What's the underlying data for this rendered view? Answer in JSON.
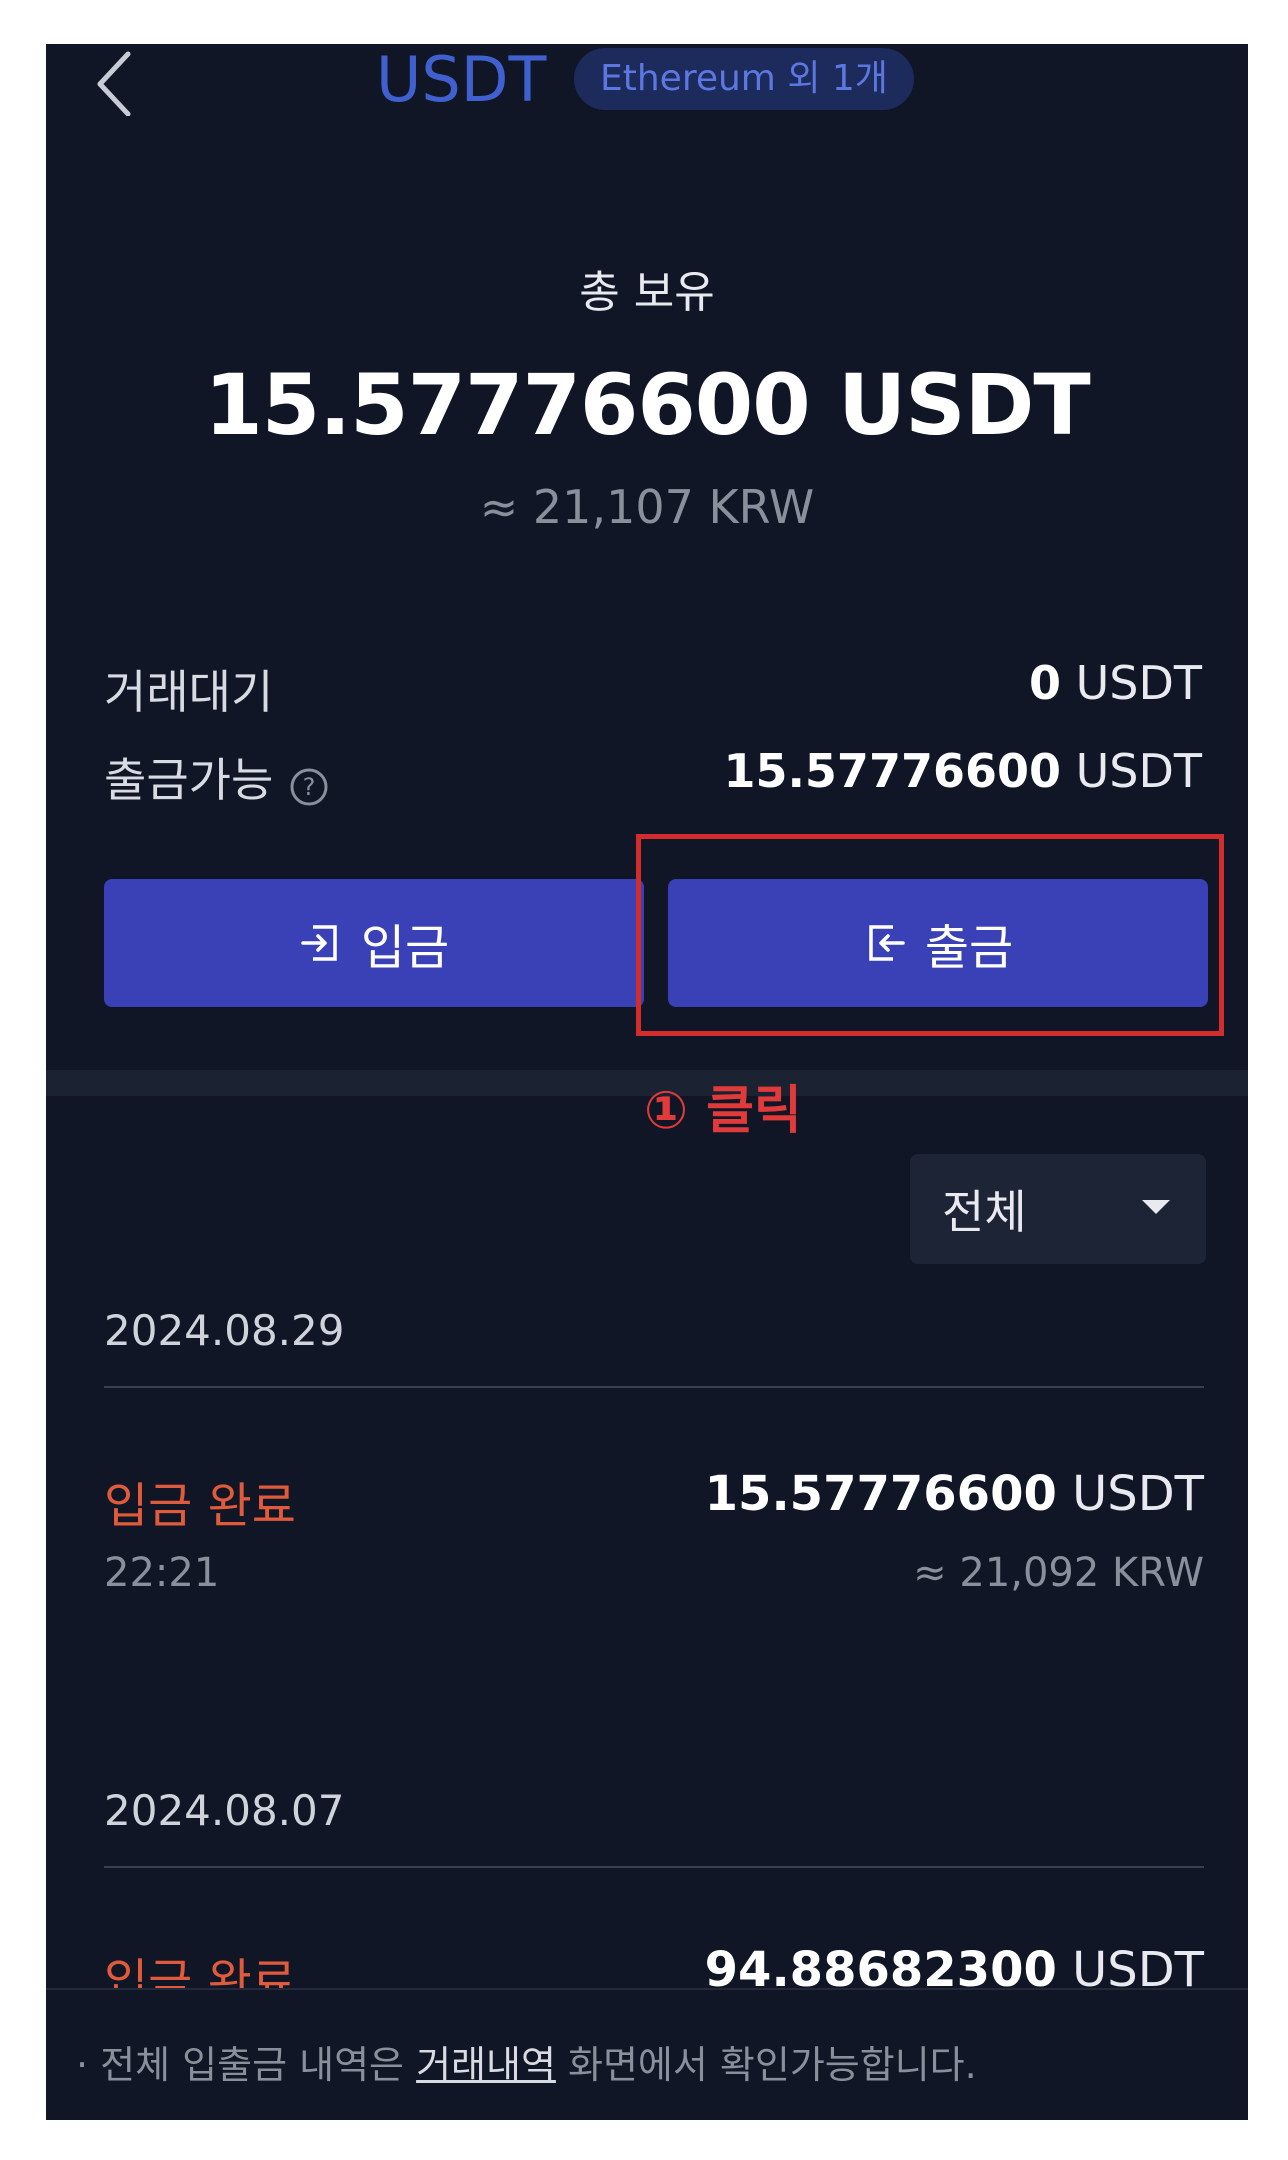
{
  "header": {
    "coin": "USDT",
    "network": "Ethereum 외 1개"
  },
  "balance": {
    "total_label": "총 보유",
    "total_amount": "15.57776600 USDT",
    "total_krw": "≈ 21,107 KRW",
    "pending_label": "거래대기",
    "pending_value": "0",
    "pending_unit": " USDT",
    "available_label": "출금가능",
    "available_value": "15.57776600",
    "available_unit": " USDT"
  },
  "actions": {
    "deposit_label": "입금",
    "withdraw_label": "출금",
    "annotation": "① 클릭"
  },
  "filter": {
    "selected": "전체"
  },
  "history": [
    {
      "date": "2024.08.29",
      "status": "입금 완료",
      "time": "22:21",
      "amount": "15.57776600",
      "unit": " USDT",
      "krw": "≈ 21,092 KRW"
    },
    {
      "date": "2024.08.07",
      "status": "입금 완료",
      "amount": "94.88682300",
      "unit": " USDT"
    }
  ],
  "footer": {
    "prefix": "· 전체 입출금 내역은 ",
    "link": "거래내역",
    "suffix": " 화면에서 확인가능합니다."
  },
  "colors": {
    "background": "#101626",
    "button": "#3a41b6",
    "accent_blue": "#4060d0",
    "status_orange": "#e05a3c",
    "annotation_red": "#e03a3a"
  }
}
